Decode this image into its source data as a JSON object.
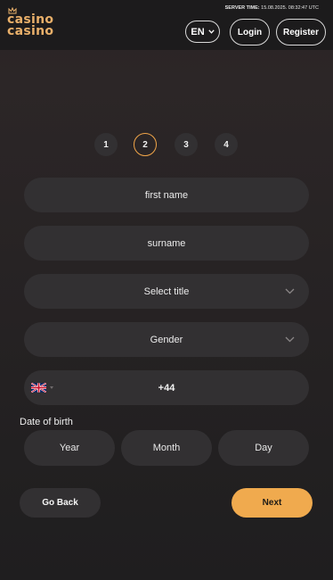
{
  "header": {
    "logo_line1": "casino",
    "logo_line2": "casino",
    "server_time_label": "SERVER TIME:",
    "server_time_value": "15.08.2025. 08:32:47 UTC",
    "language": "EN",
    "login_label": "Login",
    "register_label": "Register"
  },
  "steps": [
    {
      "label": "1",
      "active": false
    },
    {
      "label": "2",
      "active": true
    },
    {
      "label": "3",
      "active": false
    },
    {
      "label": "4",
      "active": false
    }
  ],
  "form": {
    "first_name_placeholder": "first name",
    "surname_placeholder": "surname",
    "title_select": "Select title",
    "gender_select": "Gender",
    "phone_code": "+44",
    "phone_country_icon": "uk-flag-icon",
    "dob_label": "Date of birth",
    "dob_year": "Year",
    "dob_month": "Month",
    "dob_day": "Day"
  },
  "actions": {
    "back_label": "Go Back",
    "next_label": "Next"
  },
  "colors": {
    "accent": "#f0aa4e",
    "field_bg": "#323032",
    "header_bg": "#1c1b1c"
  }
}
